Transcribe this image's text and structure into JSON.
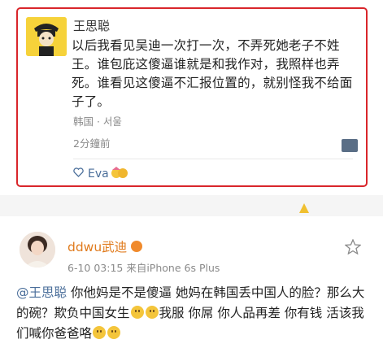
{
  "post1": {
    "username": "王思聪",
    "text": "以后我看见吴迪一次打一次，不弄死她老子不姓王。谁包庇这傻逼谁就是和我作对，我照样也弄死。谁看见这傻逼不汇报位置的，就别怪我不给面子了。",
    "location": "韩国 · 서울",
    "time": "2分鐘前",
    "like_user": "Eva",
    "icons": {
      "avatar": "cartoon-avatar-icon",
      "card": "card-icon",
      "like": "heart-icon",
      "emoji": "emoji-icon"
    }
  },
  "post2": {
    "username": "ddwu武迪",
    "meta": "6-10 03:15  来自iPhone 6s Plus",
    "mention": "@王思聪",
    "text_a": " 你他妈是不是傻逼 她妈在韩国丢中国人的脸？那么大的碗？欺负中国女生",
    "text_b": "我服 你屌 你人品再差 你有钱 活该我们喊你爸爸咯",
    "icons": {
      "avatar": "profile-photo",
      "star": "star-icon",
      "emoji": "emoji-icon"
    }
  },
  "colors": {
    "highlight_border": "#d9262b",
    "username2": "#e07b1e",
    "link": "#4a6e9a"
  }
}
